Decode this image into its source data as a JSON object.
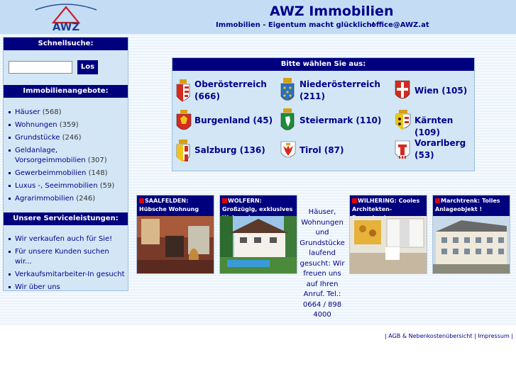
{
  "header": {
    "logo_text": "AWZ",
    "title": "AWZ Immobilien",
    "tagline": "Immobilien - Eigentum macht glücklich!",
    "email": "office@AWZ.at"
  },
  "sidebar": {
    "search_heading": "Schnellsuche:",
    "search_placeholder": "",
    "search_button": "Los",
    "offers_heading": "Immobilienangebote:",
    "offers": [
      {
        "label": "Häuser",
        "count": "(568)"
      },
      {
        "label": "Wohnungen",
        "count": "(359)"
      },
      {
        "label": "Grundstücke",
        "count": "(246)"
      },
      {
        "label": "Geldanlage, Vorsorgeimmobilien",
        "count": "(307)"
      },
      {
        "label": "Gewerbeimmobilien",
        "count": "(148)"
      },
      {
        "label": "Luxus -, Seeimmobilien",
        "count": "(59)"
      },
      {
        "label": "Agrarimmobilien",
        "count": "(246)"
      }
    ],
    "services_heading": "Unsere Serviceleistungen:",
    "services": [
      "Wir verkaufen auch für Sie!",
      "Für unsere Kunden suchen wir...",
      "Verkaufsmitarbeiter-In gesucht",
      "Wir über uns"
    ]
  },
  "regions": {
    "heading": "Bitte wählen Sie aus:",
    "items": [
      {
        "name": "Oberösterreich",
        "count": "(666)"
      },
      {
        "name": "Niederösterreich",
        "count": "(211)"
      },
      {
        "name": "Wien",
        "count": "(105)"
      },
      {
        "name": "Burgenland",
        "count": "(45)"
      },
      {
        "name": "Steiermark",
        "count": "(110)"
      },
      {
        "name": "Kärnten",
        "count": "(109)"
      },
      {
        "name": "Salzburg",
        "count": "(136)"
      },
      {
        "name": "Tirol",
        "count": "(87)"
      },
      {
        "name": "Vorarlberg",
        "count": "(53)"
      }
    ]
  },
  "listings": [
    {
      "title": "SAALFELDEN: Hübsche Wohnung"
    },
    {
      "title": "WOLFERN: Großzügig, exklusives Wohnen!"
    },
    {
      "title": "WILHERING: Cooles Architekten-Bungalow!"
    },
    {
      "title": "Marchtrenk: Tolles Anlageobjekt !"
    }
  ],
  "promo": {
    "text": "Häuser, Wohnungen und Grundstücke laufend gesucht: Wir freuen uns auf Ihren Anruf. Tel.: 0664 / 898 4000"
  },
  "footer": {
    "sep": "|",
    "agb": "AGB & Nebenkostenübersicht",
    "impressum": "Impressum"
  },
  "colors": {
    "header_bg": "#c5ddf4",
    "navy": "#00007f",
    "panel_bg": "#d3e6f6",
    "link": "#00008b",
    "accent_red": "#e00000"
  }
}
